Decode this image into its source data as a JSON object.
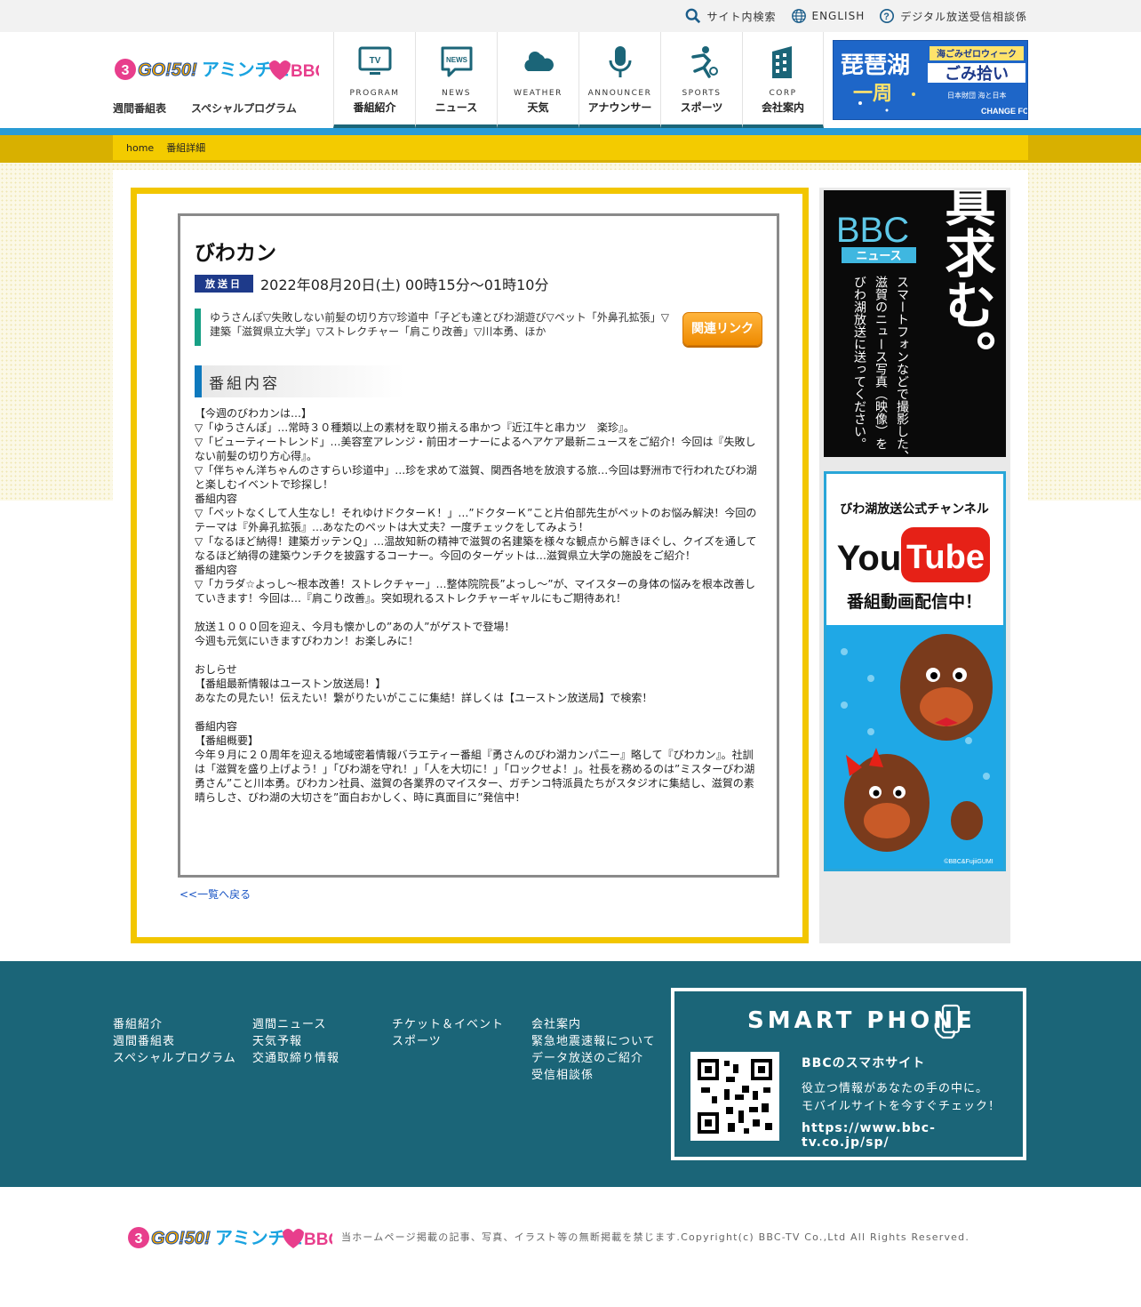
{
  "util": {
    "search": "サイト内検索",
    "english": "ENGLISH",
    "digital": "デジタル放送受信相談係"
  },
  "header": {
    "subnav": [
      "週間番組表",
      "スペシャルプログラム"
    ],
    "nav": [
      {
        "en": "PROGRAM",
        "ja": "番組紹介",
        "icon": "tv-icon"
      },
      {
        "en": "NEWS",
        "ja": "ニュース",
        "icon": "news-icon"
      },
      {
        "en": "WEATHER",
        "ja": "天気",
        "icon": "cloud-icon"
      },
      {
        "en": "ANNOUNCER",
        "ja": "アナウンサー",
        "icon": "microphone-icon"
      },
      {
        "en": "SPORTS",
        "ja": "スポーツ",
        "icon": "athlete-icon"
      },
      {
        "en": "CORP",
        "ja": "会社案内",
        "icon": "building-icon"
      }
    ],
    "banner": {
      "line1": "琵琶湖",
      "line2": "一周",
      "tag": "海ごみゼロウィーク",
      "title": "ごみ拾い",
      "org": "日本財団 海と日本",
      "change": "CHANGE FOR THE BLUE"
    }
  },
  "breadcrumb": [
    "home",
    "番組詳細"
  ],
  "program": {
    "title": "びわカン",
    "air_label": "放送日",
    "air_date": "2022年08月20日(土) 00時15分～01時10分",
    "summary": "ゆうさんぽ▽失敗しない前髪の切り方▽珍道中「子ども達とびわ湖遊び▽ペット「外鼻孔拡張」▽建築「滋賀県立大学」▽ストレクチャー「肩こり改善」▽川本勇、ほか",
    "related_link": "関連リンク",
    "section_title": "番組内容",
    "body": "【今週のびわカンは…】\n▽「ゆうさんぽ」…常時３０種類以上の素材を取り揃える串かつ『近江牛と串カツ　楽珍』。\n▽「ビューティートレンド」…美容室アレンジ・前田オーナーによるヘアケア最新ニュースをご紹介！今回は『失敗しない前髪の切り方心得』。\n▽「伴ちゃん洋ちゃんのさすらい珍道中」…珍を求めて滋賀、関西各地を放浪する旅…今回は野洲市で行われたびわ湖と楽しむイベントで珍探し！\n番組内容\n▽「ペットなくして人生なし！それゆけドクターＫ！」…”ドクターＫ”こと片伯部先生がペットのお悩み解決！今回のテーマは『外鼻孔拡張』…あなたのペットは大丈夫？一度チェックをしてみよう！\n▽「なるほど納得！建築ガッテンＱ」…温故知新の精神で滋賀の名建築を様々な観点から解きほぐし、クイズを通してなるほど納得の建築ウンチクを披露するコーナー。今回のターゲットは…滋賀県立大学の施設をご紹介！\n番組内容\n▽「カラダ☆よっし～根本改善！ストレクチャー」…整体院院長”よっし～”が、マイスターの身体の悩みを根本改善していきます！今回は…『肩こり改善』。突如現れるストレクチャーギャルにもご期待あれ！\n\n放送１０００回を迎え、今月も懐かしの”あの人”がゲストで登場！\n今週も元気にいきますびわカン！お楽しみに！\n\nおしらせ\n【番組最新情報はユーストン放送局！】\nあなたの見たい！伝えたい！繋がりたいがここに集結！詳しくは【ユーストン放送局】で検索！\n\n番組内容\n【番組概要】\n今年９月に２０周年を迎える地域密着情報バラエティー番組『勇さんのびわ湖カンパニー』略して『びわカン』。社訓は「滋賀を盛り上げよう！」「びわ湖を守れ！」「人を大切に！」「ロックせよ！」。社長を務めるのは”ミスターびわ湖勇さん”こと川本勇。びわカン社員、滋賀の各業界のマイスター、ガチンコ特派員たちがスタジオに集結し、滋賀の素晴らしさ、びわ湖の大切さを”面白おかしく、時に真面目に”発信中！",
    "back_link": "<<一覧へ戻る"
  },
  "aside": {
    "ad1": {
      "logo": "BBC",
      "logo_sub": "ニュース",
      "headline": "写真求む。",
      "text1": "スマートフォンなどで撮影した、",
      "text2": "滋賀のニュース写真（映像）を",
      "text3": "びわ湖放送に送ってください。"
    },
    "ad2": {
      "top": "びわ湖放送公式チャンネル",
      "you": "You",
      "tube": "Tube",
      "sub": "番組動画配信中！",
      "credit": "©BBC&FujiiGUMI"
    }
  },
  "footer": {
    "col1": [
      "番組紹介",
      "週間番組表",
      "スペシャルプログラム"
    ],
    "col2": [
      "週間ニュース",
      "天気予報",
      "交通取締り情報"
    ],
    "col3": [
      "チケット＆イベント",
      "スポーツ"
    ],
    "col4": [
      "会社案内",
      "緊急地震速報について",
      "データ放送のご紹介",
      "受信相談係"
    ],
    "smartphone": {
      "title": "SMART PHONE",
      "subtitle": "BBCのスマホサイト",
      "desc1": "役立つ情報があなたの手の中に。",
      "desc2": "モバイルサイトを今すぐチェック！",
      "url": "https://www.bbc-tv.co.jp/sp/"
    }
  },
  "copyright": "当ホームページ掲載の記事、写真、イラスト等の無断掲載を禁じます.Copyright(c) BBC-TV Co.,Ltd All Rights Reserved.",
  "colors": {
    "accent_teal": "#1b6578",
    "frame_yellow": "#f2c600",
    "band_blue": "#2a9bd4"
  }
}
